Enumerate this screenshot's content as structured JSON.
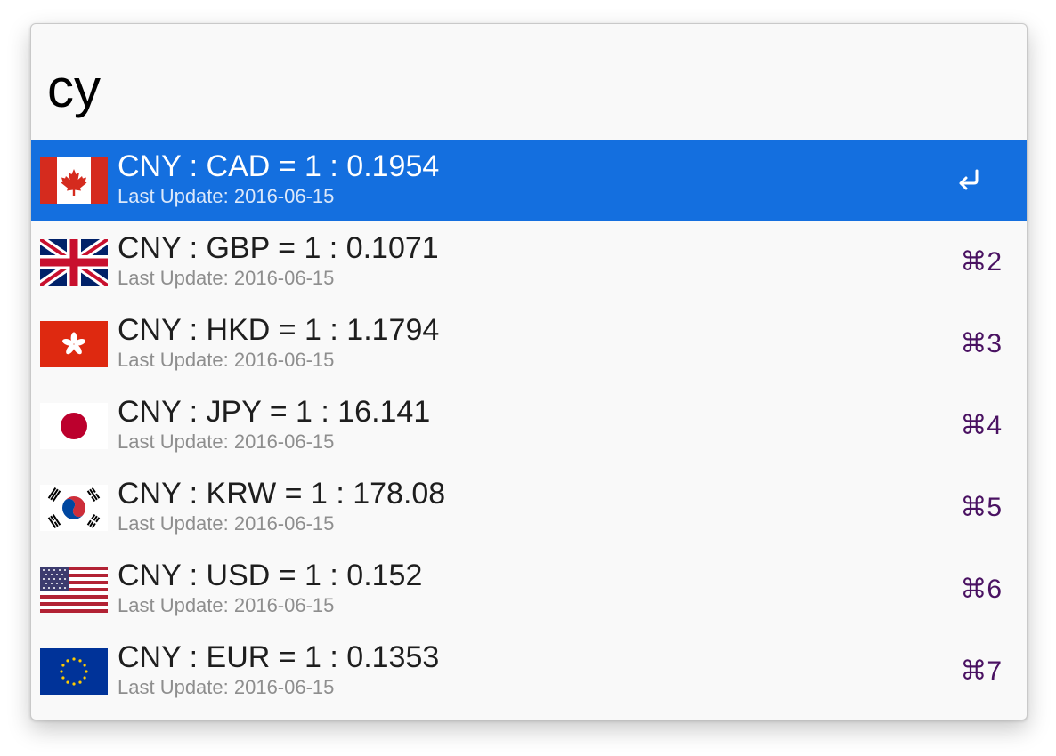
{
  "search": {
    "query": "cy"
  },
  "results": [
    {
      "flag": "canada-flag-icon",
      "title": "CNY : CAD = 1 : 0.1954",
      "subtitle": "Last Update: 2016-06-15",
      "action_icon": "return-icon",
      "selected": true
    },
    {
      "flag": "uk-flag-icon",
      "title": "CNY : GBP = 1 : 0.1071",
      "subtitle": "Last Update: 2016-06-15",
      "shortcut": "⌘2"
    },
    {
      "flag": "hong-kong-flag-icon",
      "title": "CNY : HKD = 1 : 1.1794",
      "subtitle": "Last Update: 2016-06-15",
      "shortcut": "⌘3"
    },
    {
      "flag": "japan-flag-icon",
      "title": "CNY : JPY = 1 : 16.141",
      "subtitle": "Last Update: 2016-06-15",
      "shortcut": "⌘4"
    },
    {
      "flag": "south-korea-flag-icon",
      "title": "CNY : KRW = 1 : 178.08",
      "subtitle": "Last Update: 2016-06-15",
      "shortcut": "⌘5"
    },
    {
      "flag": "us-flag-icon",
      "title": "CNY : USD = 1 : 0.152",
      "subtitle": "Last Update: 2016-06-15",
      "shortcut": "⌘6"
    },
    {
      "flag": "eu-flag-icon",
      "title": "CNY : EUR = 1 : 0.1353",
      "subtitle": "Last Update: 2016-06-15",
      "shortcut": "⌘7"
    }
  ],
  "colors": {
    "selection": "#146fdf",
    "shortcut": "#4a1262",
    "subtitle": "#8e8e8e",
    "background": "#f9f9f9"
  }
}
